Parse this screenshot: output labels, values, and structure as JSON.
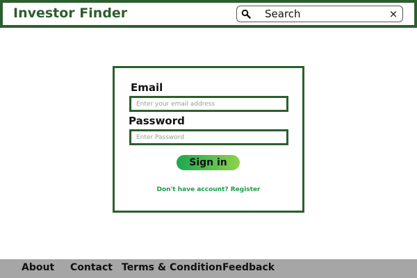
{
  "header": {
    "brand": "Investor Finder",
    "search": {
      "placeholder": "Search",
      "search_icon": "search-icon",
      "clear_icon": "close-icon",
      "clear_glyph": "×"
    }
  },
  "login": {
    "email_label": "Email",
    "email_placeholder": "Enter your email address",
    "password_label": "Password",
    "password_placeholder": "Enter Password",
    "signin_label": "Sign in",
    "no_account_text": "Don't have account?",
    "register_label": "Register"
  },
  "footer": {
    "links": [
      "About",
      "Contact",
      "Terms & Condition",
      "Feedback"
    ]
  },
  "colors": {
    "brand_green": "#2c5e2e",
    "link_green": "#1e9a4a",
    "button_gradient_start": "#1ea650",
    "button_gradient_end": "#8ed24e",
    "footer_gray": "#a6a6a6"
  }
}
